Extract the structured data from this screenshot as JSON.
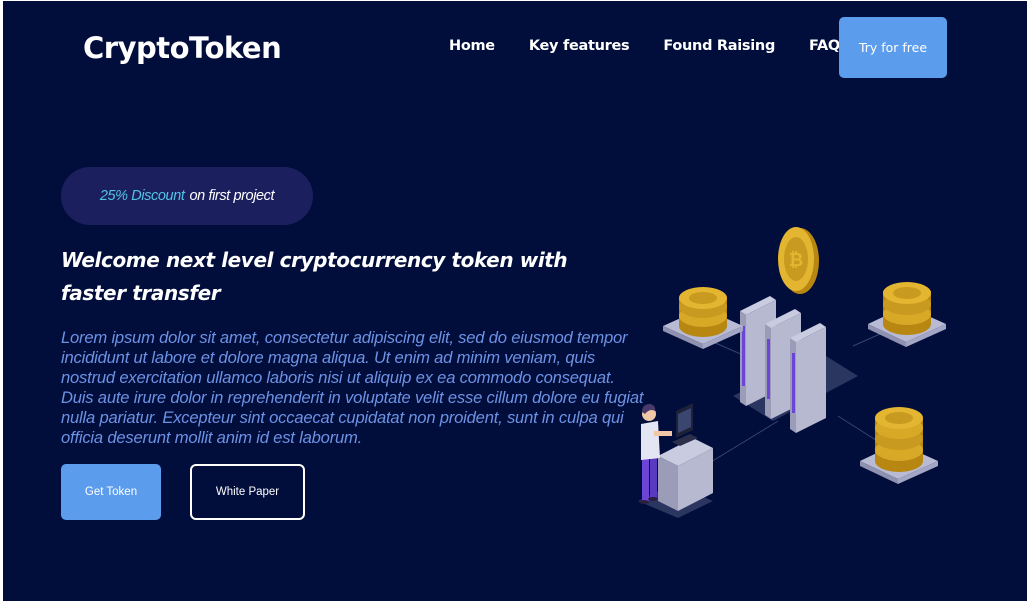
{
  "brand": {
    "name": "CryptoToken"
  },
  "nav": {
    "items": [
      {
        "label": "Home"
      },
      {
        "label": "Key features"
      },
      {
        "label": "Found Raising"
      },
      {
        "label": "FAQ"
      }
    ],
    "cta_label": "Try for free"
  },
  "hero": {
    "promo": {
      "highlight": "25% Discount",
      "rest": "on first project"
    },
    "headline": "Welcome next level cryptocurrency token with faster transfer",
    "body": "Lorem ipsum dolor sit amet, consectetur adipiscing elit, sed do eiusmod tempor incididunt ut labore et dolore magna aliqua. Ut enim ad minim veniam, quis nostrud exercitation ullamco laboris nisi ut aliquip ex ea commodo consequat. Duis aute irure dolor in reprehenderit in voluptate velit esse cillum dolore eu fugiat nulla pariatur. Excepteur sint occaecat cupidatat non proident, sunt in culpa qui officia deserunt mollit anim id est laborum.",
    "primary_button": "Get Token",
    "secondary_button": "White Paper"
  },
  "colors": {
    "background": "#010d3b",
    "accent": "#5c9ced",
    "promo_bg": "#1c1f5e",
    "promo_highlight": "#51c3e5",
    "body_text": "#6d92e4",
    "coin_gold": "#d8a827",
    "server_stripe": "#6c45d6"
  },
  "illustration": {
    "icons": [
      "bitcoin-coin-icon",
      "coin-stack-icon",
      "server-rack-icon",
      "person-at-computer-icon"
    ]
  }
}
